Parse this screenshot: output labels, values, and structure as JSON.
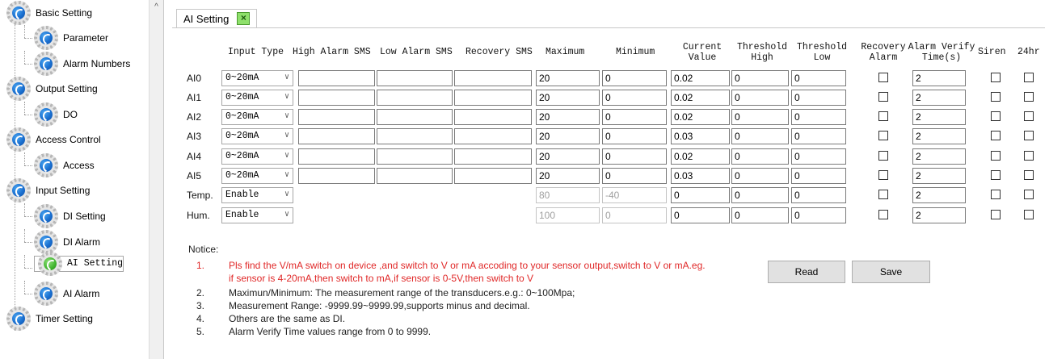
{
  "sidebar": {
    "items": [
      {
        "label": "Basic Setting",
        "level": 0
      },
      {
        "label": "Parameter",
        "level": 1
      },
      {
        "label": "Alarm Numbers",
        "level": 1
      },
      {
        "label": "Output Setting",
        "level": 0
      },
      {
        "label": "DO",
        "level": 1
      },
      {
        "label": "Access Control",
        "level": 0
      },
      {
        "label": "Access",
        "level": 1
      },
      {
        "label": "Input Setting",
        "level": 0
      },
      {
        "label": "DI Setting",
        "level": 1
      },
      {
        "label": "DI Alarm",
        "level": 1
      },
      {
        "label": "AI  Setting",
        "level": 1,
        "selected": true
      },
      {
        "label": "AI Alarm",
        "level": 1
      },
      {
        "label": "Timer Setting",
        "level": 0
      }
    ]
  },
  "tab": {
    "label": "AI  Setting",
    "close_symbol": "×"
  },
  "columns": {
    "input_type": "Input Type",
    "high_alarm_sms": "High Alarm SMS",
    "low_alarm_sms": "Low Alarm SMS",
    "recovery_sms": "Recovery SMS",
    "maximum": "Maximum",
    "minimum": "Minimum",
    "current_value": [
      "Current",
      "Value"
    ],
    "threshold_high": [
      "Threshold",
      "High"
    ],
    "threshold_low": [
      "Threshold",
      "Low"
    ],
    "recovery_alarm": [
      "Recovery",
      "Alarm"
    ],
    "alarm_verify_time": [
      "Alarm Verify",
      "Time(s)"
    ],
    "siren": "Siren",
    "24hr": "24hr"
  },
  "rows": [
    {
      "label": "AI0",
      "input_type": "0~20mA",
      "high_sms": "",
      "low_sms": "",
      "recovery_sms": "",
      "maximum": "20",
      "minimum": "0",
      "current": "0.02",
      "th_high": "0",
      "th_low": "0",
      "recovery_alarm": false,
      "verify_time": "2",
      "siren": false,
      "h24": false
    },
    {
      "label": "AI1",
      "input_type": "0~20mA",
      "high_sms": "",
      "low_sms": "",
      "recovery_sms": "",
      "maximum": "20",
      "minimum": "0",
      "current": "0.02",
      "th_high": "0",
      "th_low": "0",
      "recovery_alarm": false,
      "verify_time": "2",
      "siren": false,
      "h24": false
    },
    {
      "label": "AI2",
      "input_type": "0~20mA",
      "high_sms": "",
      "low_sms": "",
      "recovery_sms": "",
      "maximum": "20",
      "minimum": "0",
      "current": "0.02",
      "th_high": "0",
      "th_low": "0",
      "recovery_alarm": false,
      "verify_time": "2",
      "siren": false,
      "h24": false
    },
    {
      "label": "AI3",
      "input_type": "0~20mA",
      "high_sms": "",
      "low_sms": "",
      "recovery_sms": "",
      "maximum": "20",
      "minimum": "0",
      "current": "0.03",
      "th_high": "0",
      "th_low": "0",
      "recovery_alarm": false,
      "verify_time": "2",
      "siren": false,
      "h24": false
    },
    {
      "label": "AI4",
      "input_type": "0~20mA",
      "high_sms": "",
      "low_sms": "",
      "recovery_sms": "",
      "maximum": "20",
      "minimum": "0",
      "current": "0.02",
      "th_high": "0",
      "th_low": "0",
      "recovery_alarm": false,
      "verify_time": "2",
      "siren": false,
      "h24": false
    },
    {
      "label": "AI5",
      "input_type": "0~20mA",
      "high_sms": "",
      "low_sms": "",
      "recovery_sms": "",
      "maximum": "20",
      "minimum": "0",
      "current": "0.03",
      "th_high": "0",
      "th_low": "0",
      "recovery_alarm": false,
      "verify_time": "2",
      "siren": false,
      "h24": false
    },
    {
      "label": "Temp.",
      "input_type": "Enable",
      "maximum": "80",
      "minimum": "-40",
      "current": "0",
      "th_high": "0",
      "th_low": "0",
      "recovery_alarm": false,
      "verify_time": "2",
      "siren": false,
      "h24": false,
      "fixed_range": true
    },
    {
      "label": "Hum.",
      "input_type": "Enable",
      "maximum": "100",
      "minimum": "0",
      "current": "0",
      "th_high": "0",
      "th_low": "0",
      "recovery_alarm": false,
      "verify_time": "2",
      "siren": false,
      "h24": false,
      "fixed_range": true
    }
  ],
  "notice": {
    "title": "Notice:",
    "items": [
      {
        "num": "1.",
        "lines": [
          "Pls find the V/mA switch on device ,and switch to V or mA accoding to your sensor output,switch to V or mA.eg.",
          " if sensor is 4-20mA,then switch to mA,if sensor is 0-5V,then switch to V"
        ],
        "color": "#e02828"
      },
      {
        "num": "2.",
        "lines": [
          "Maximun/Minimum: The measurement range of the transducers.e.g.: 0~100Mpa;"
        ]
      },
      {
        "num": "3.",
        "lines": [
          "Measurement Range: -9999.99~9999.99,supports minus and decimal."
        ]
      },
      {
        "num": "4.",
        "lines": [
          "Others are the same as DI."
        ]
      },
      {
        "num": "5.",
        "lines": [
          "Alarm Verify Time values range from 0 to 9999."
        ]
      }
    ]
  },
  "buttons": {
    "read": "Read",
    "save": "Save"
  },
  "colors": {
    "notice_red": "#e02828",
    "tab_close_green": "#8ee06b",
    "gear_blue": "#1a6fd0"
  }
}
